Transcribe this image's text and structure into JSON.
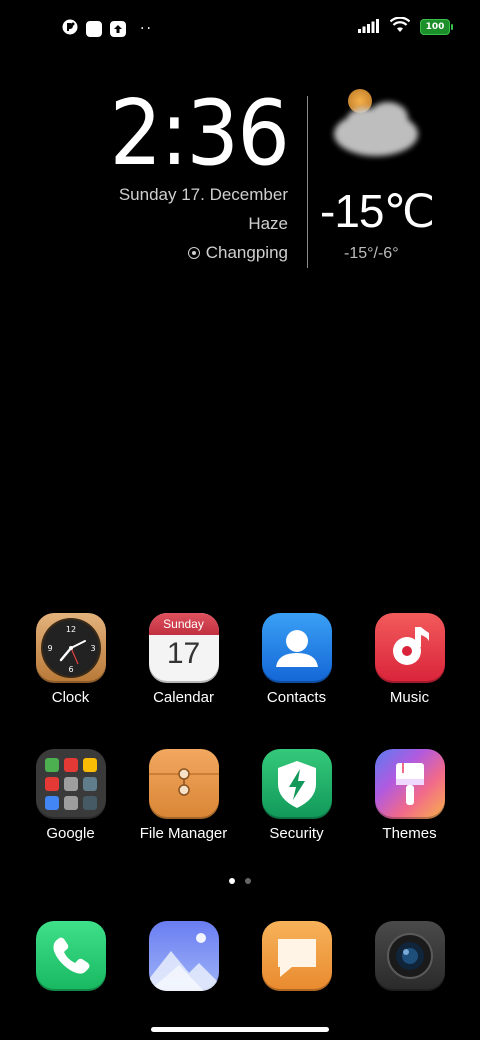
{
  "status_bar": {
    "battery": "100",
    "icons": [
      "app-notification-icon",
      "square-notification-icon",
      "upload-icon",
      "more-dots-icon",
      "signal-icon",
      "wifi-icon",
      "battery-icon"
    ],
    "more": "··"
  },
  "widget": {
    "time": "2:36",
    "date": "Sunday 17. December",
    "weather": "Haze",
    "location": "Changping",
    "temperature": "-15℃",
    "range": "-15°/-6°",
    "weather_icon": "haze-cloud-sun-icon"
  },
  "apps_row1": [
    {
      "label": "Clock",
      "icon": "clock-icon"
    },
    {
      "label": "Calendar",
      "icon": "calendar-icon",
      "day_name": "Sunday",
      "day": "17"
    },
    {
      "label": "Contacts",
      "icon": "contacts-icon"
    },
    {
      "label": "Music",
      "icon": "music-icon"
    }
  ],
  "apps_row2": [
    {
      "label": "Google",
      "icon": "google-folder-icon"
    },
    {
      "label": "File Manager",
      "icon": "file-manager-icon"
    },
    {
      "label": "Security",
      "icon": "security-icon"
    },
    {
      "label": "Themes",
      "icon": "themes-icon"
    }
  ],
  "dock": [
    {
      "icon": "phone-icon"
    },
    {
      "icon": "gallery-icon"
    },
    {
      "icon": "messaging-icon"
    },
    {
      "icon": "camera-icon"
    }
  ],
  "page_indicator": {
    "pages": 2,
    "current": 1
  },
  "colors": {
    "background": "#000000",
    "battery": "#1c8f2a"
  }
}
